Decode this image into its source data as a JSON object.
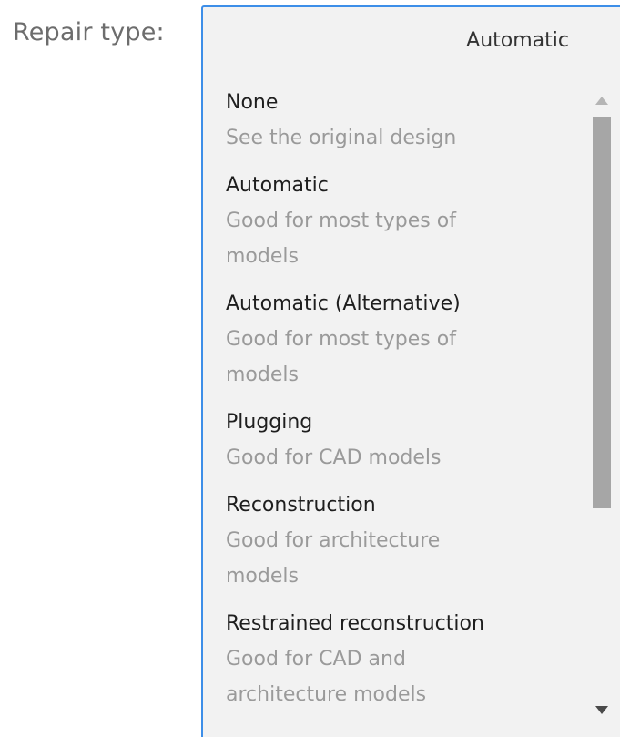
{
  "field": {
    "label": "Repair type:",
    "selected_value": "Automatic"
  },
  "options": [
    {
      "title": "None",
      "description": "See the original design"
    },
    {
      "title": "Automatic",
      "description": "Good for most types of models"
    },
    {
      "title": "Automatic (Alternative)",
      "description": "Good for most types of models"
    },
    {
      "title": "Plugging",
      "description": "Good for CAD models"
    },
    {
      "title": "Reconstruction",
      "description": "Good for architecture models"
    },
    {
      "title": "Restrained reconstruction",
      "description": "Good for CAD and architecture models"
    }
  ],
  "icons": {
    "scroll_up": "triangle-up-icon",
    "scroll_down": "triangle-down-icon"
  },
  "colors": {
    "accent_border": "#3d8ee8",
    "dropdown_bg": "#f2f2f2",
    "scroll_thumb": "#a6a6a6"
  }
}
